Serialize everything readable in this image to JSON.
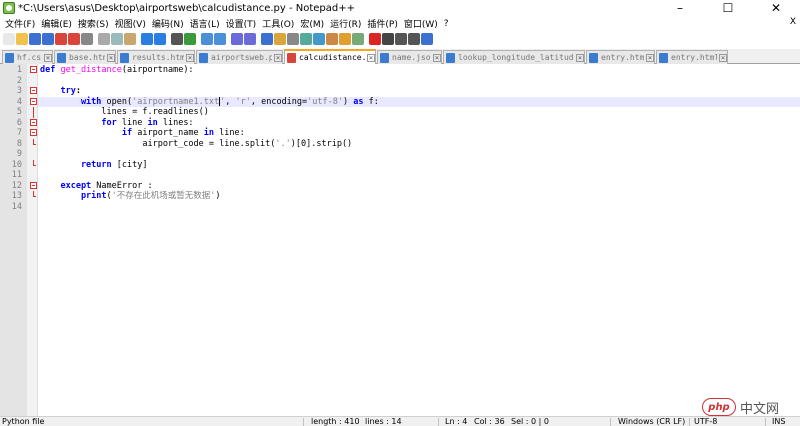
{
  "window": {
    "title": "*C:\\Users\\asus\\Desktop\\airportsweb\\calcudistance.py - Notepad++"
  },
  "menu": [
    "文件(F)",
    "编辑(E)",
    "搜索(S)",
    "视图(V)",
    "编码(N)",
    "语言(L)",
    "设置(T)",
    "工具(O)",
    "宏(M)",
    "运行(R)",
    "插件(P)",
    "窗口(W)",
    "?"
  ],
  "menu_close": "X",
  "toolbar_icons": [
    "new-file-icon",
    "open-file-icon",
    "save-icon",
    "save-all-icon",
    "close-icon",
    "close-all-icon",
    "print-icon",
    "cut-icon",
    "copy-icon",
    "paste-icon",
    "undo-icon",
    "redo-icon",
    "find-icon",
    "replace-icon",
    "zoom-in-icon",
    "zoom-out-icon",
    "sync-vertical-icon",
    "sync-horizontal-icon",
    "word-wrap-icon",
    "show-all-chars-icon",
    "indent-guide-icon",
    "user-language-icon",
    "doc-map-icon",
    "function-list-icon",
    "folder-as-workspace-icon",
    "monitoring-icon",
    "record-macro-icon",
    "stop-record-icon",
    "play-macro-icon",
    "run-macro-multiple-icon",
    "save-macro-icon"
  ],
  "tabs": [
    {
      "label": "hf.css",
      "active": false,
      "modified": false
    },
    {
      "label": "base.html",
      "active": false,
      "modified": false
    },
    {
      "label": "results.html",
      "active": false,
      "modified": false
    },
    {
      "label": "airportsweb.py",
      "active": false,
      "modified": false
    },
    {
      "label": "calcudistance.py",
      "active": true,
      "modified": true
    },
    {
      "label": "name.json",
      "active": false,
      "modified": false
    },
    {
      "label": "lookup_longitude_latitude.py",
      "active": false,
      "modified": false
    },
    {
      "label": "entry.html",
      "active": false,
      "modified": false
    },
    {
      "label": "entry.html",
      "active": false,
      "modified": false
    }
  ],
  "code_lines": [
    {
      "n": "1",
      "tokens": [
        [
          "kw",
          "def "
        ],
        [
          "fn",
          "get_distance"
        ],
        [
          "",
          "(airportname):"
        ]
      ]
    },
    {
      "n": "2",
      "tokens": []
    },
    {
      "n": "3",
      "tokens": [
        [
          "kw",
          "    try"
        ],
        [
          "op",
          ":"
        ]
      ]
    },
    {
      "n": "4",
      "tokens": [
        [
          "kw",
          "        with "
        ],
        [
          "",
          "open("
        ],
        [
          "str",
          "'airportname1.txt"
        ],
        [
          "cursor",
          ""
        ],
        [
          "str",
          "'"
        ],
        [
          "",
          ", "
        ],
        [
          "str",
          "'r'"
        ],
        [
          "",
          ", encoding="
        ],
        [
          "str",
          "'utf-8'"
        ],
        [
          "",
          ") "
        ],
        [
          "kw",
          "as "
        ],
        [
          "",
          "f:"
        ]
      ]
    },
    {
      "n": "5",
      "tokens": [
        [
          "",
          "            lines = f.readlines()"
        ]
      ]
    },
    {
      "n": "6",
      "tokens": [
        [
          "kw",
          "            for "
        ],
        [
          "",
          "line "
        ],
        [
          "kw",
          "in "
        ],
        [
          "",
          "lines:"
        ]
      ]
    },
    {
      "n": "7",
      "tokens": [
        [
          "kw",
          "                if "
        ],
        [
          "",
          "airport_name "
        ],
        [
          "kw",
          "in "
        ],
        [
          "",
          "line:"
        ]
      ]
    },
    {
      "n": "8",
      "tokens": [
        [
          "",
          "                    airport_code = line.split("
        ],
        [
          "str",
          "'.'"
        ],
        [
          "",
          ")[0].strip()"
        ]
      ]
    },
    {
      "n": "9",
      "tokens": []
    },
    {
      "n": "10",
      "tokens": [
        [
          "kw",
          "        return "
        ],
        [
          "",
          "[city]"
        ]
      ]
    },
    {
      "n": "11",
      "tokens": []
    },
    {
      "n": "12",
      "tokens": [
        [
          "kw",
          "    except "
        ],
        [
          "",
          "NameError :"
        ]
      ]
    },
    {
      "n": "13",
      "tokens": [
        [
          "kw",
          "        print"
        ],
        [
          "",
          "("
        ],
        [
          "str",
          "'不存在此机场或暂无数据'"
        ],
        [
          "",
          ")"
        ]
      ]
    },
    {
      "n": "14",
      "tokens": []
    }
  ],
  "fold_markers": [
    "box",
    "",
    "box",
    "box",
    "vline",
    "box",
    "box",
    "end",
    "",
    "end",
    "",
    "box",
    "end",
    ""
  ],
  "status": {
    "language": "Python file",
    "length": "length : 410",
    "lines": "lines : 14",
    "ln": "Ln : 4",
    "col": "Col : 36",
    "sel": "Sel : 0 | 0",
    "eol": "Windows (CR LF)",
    "encoding": "UTF-8",
    "mode": "INS"
  },
  "watermark": {
    "logo": "php",
    "text": "中文网"
  }
}
